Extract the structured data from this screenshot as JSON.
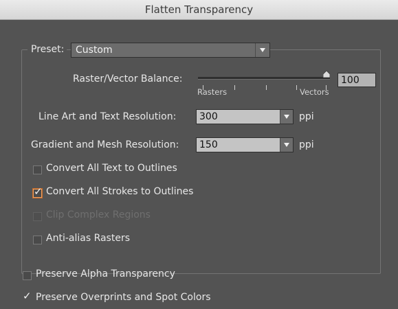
{
  "window": {
    "title": "Flatten Transparency"
  },
  "preset": {
    "label": "Preset:",
    "value": "Custom"
  },
  "balance": {
    "label": "Raster/Vector Balance:",
    "value": "100",
    "slider_level_percent": 100,
    "left_label": "Rasters",
    "right_label": "Vectors"
  },
  "line_art": {
    "label": "Line Art and Text Resolution:",
    "value": "300",
    "unit": "ppi"
  },
  "gradient": {
    "label": "Gradient and Mesh Resolution:",
    "value": "150",
    "unit": "ppi"
  },
  "options": {
    "convert_text": {
      "label": "Convert All Text to Outlines",
      "checked": false
    },
    "convert_strokes": {
      "label": "Convert All Strokes to Outlines",
      "checked": true
    },
    "clip_complex": {
      "label": "Clip Complex Regions",
      "checked": false,
      "disabled": true
    },
    "anti_alias": {
      "label": "Anti-alias Rasters",
      "checked": false
    }
  },
  "bottom_options": {
    "preserve_alpha": {
      "label": "Preserve Alpha Transparency",
      "checked": false
    },
    "preserve_overprints": {
      "label": "Preserve Overprints and Spot Colors",
      "checked": true
    }
  },
  "colors": {
    "background": "#535353",
    "focus_accent": "#f0a060"
  },
  "icons": {
    "dropdown": "chevron-down-icon",
    "check": "checkmark-icon"
  }
}
